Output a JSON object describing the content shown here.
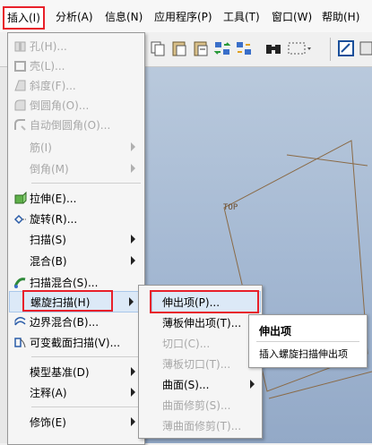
{
  "menubar": {
    "items": [
      "插入(I)",
      "分析(A)",
      "信息(N)",
      "应用程序(P)",
      "工具(T)",
      "窗口(W)",
      "帮助(H)"
    ]
  },
  "canvas": {
    "label": "TOP"
  },
  "insert_menu": {
    "items": [
      {
        "label": "孔(H)...",
        "icon": "hole-icon"
      },
      {
        "label": "壳(L)...",
        "icon": "shell-icon"
      },
      {
        "label": "斜度(F)...",
        "icon": "draft-icon"
      },
      {
        "label": "倒圆角(O)...",
        "icon": "round-icon"
      },
      {
        "label": "自动倒圆角(O)...",
        "icon": "auto-round-icon"
      },
      {
        "label": "筋(I)"
      },
      {
        "label": "倒角(M)"
      },
      {
        "label": "拉伸(E)...",
        "icon": "extrude-icon"
      },
      {
        "label": "旋转(R)...",
        "icon": "revolve-icon"
      },
      {
        "label": "扫描(S)"
      },
      {
        "label": "混合(B)"
      },
      {
        "label": "扫描混合(S)...",
        "icon": "swept-blend-icon"
      },
      {
        "label": "螺旋扫描(H)"
      },
      {
        "label": "边界混合(B)...",
        "icon": "boundary-blend-icon"
      },
      {
        "label": "可变截面扫描(V)...",
        "icon": "variable-sweep-icon"
      },
      {
        "label": "模型基准(D)"
      },
      {
        "label": "注释(A)"
      },
      {
        "label": "修饰(E)"
      }
    ]
  },
  "helical_submenu": {
    "items": [
      {
        "label": "伸出项(P)..."
      },
      {
        "label": "薄板伸出项(T)..."
      },
      {
        "label": "切口(C)..."
      },
      {
        "label": "薄板切口(T)..."
      },
      {
        "label": "曲面(S)..."
      },
      {
        "label": "曲面修剪(S)..."
      },
      {
        "label": "薄曲面修剪(T)..."
      }
    ]
  },
  "tooltip": {
    "title": "伸出项",
    "description": "插入螺旋扫描伸出项"
  }
}
